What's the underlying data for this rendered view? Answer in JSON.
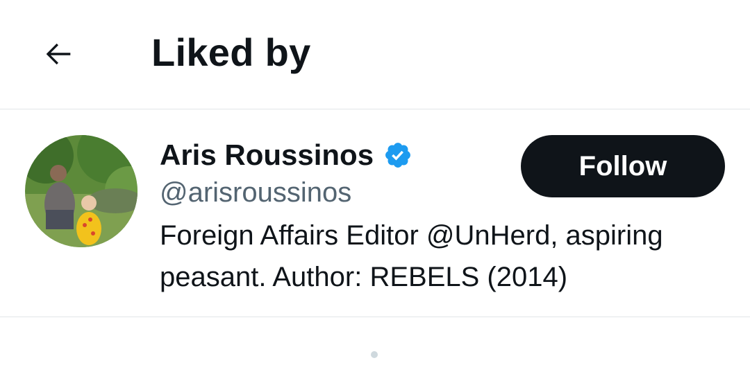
{
  "header": {
    "title": "Liked by",
    "back_icon": "arrow-left-icon"
  },
  "users": [
    {
      "display_name": "Aris Roussinos",
      "verified": true,
      "handle": "@arisroussinos",
      "bio": "Foreign Affairs Editor @UnHerd, aspiring peasant. Author: REBELS (2014)",
      "follow_label": "Follow",
      "avatar_icon": "profile-photo"
    }
  ],
  "colors": {
    "text_primary": "#0f1419",
    "text_secondary": "#536471",
    "verified_blue": "#1d9bf0",
    "divider": "#e1e5e8",
    "button_bg": "#0f1419"
  }
}
